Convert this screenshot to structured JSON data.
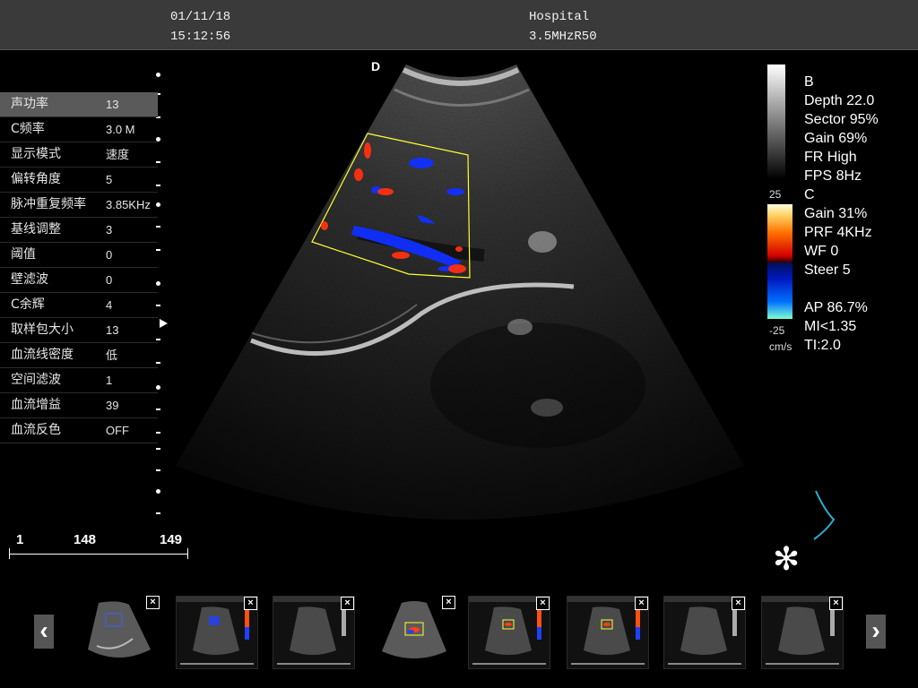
{
  "header": {
    "date": "01/11/18",
    "time": "15:12:56",
    "institution": "Hospital",
    "probe": "3.5MHzR50"
  },
  "orientation_marker": "D",
  "params": [
    {
      "label": "声功率",
      "value": "13",
      "selected": true
    },
    {
      "label": "C频率",
      "value": "3.0 M"
    },
    {
      "label": "显示模式",
      "value": "速度"
    },
    {
      "label": "偏转角度",
      "value": "5"
    },
    {
      "label": "脉冲重复频率",
      "value": "3.85KHz"
    },
    {
      "label": "基线调整",
      "value": "3"
    },
    {
      "label": "阈值",
      "value": "0"
    },
    {
      "label": "壁滤波",
      "value": "0"
    },
    {
      "label": "C余辉",
      "value": "4"
    },
    {
      "label": "取样包大小",
      "value": "13"
    },
    {
      "label": "血流线密度",
      "value": "低"
    },
    {
      "label": "空间滤波",
      "value": "1"
    },
    {
      "label": "血流增益",
      "value": "39"
    },
    {
      "label": "血流反色",
      "value": "OFF"
    }
  ],
  "info": {
    "b_mode": "B",
    "depth": "Depth 22.0",
    "sector": "Sector 95%",
    "gain": "Gain 69%",
    "fr": "FR High",
    "fps": "FPS 8Hz",
    "c_mode": "C",
    "c_gain": "Gain  31%",
    "prf": "PRF 4KHz",
    "wf": "WF 0",
    "steer": "Steer 5",
    "ap": "AP 86.7%",
    "mi": "MI<1.35",
    "ti": "TI:2.0"
  },
  "color_scale": {
    "max": "25",
    "min": "-25",
    "unit": "cm/s"
  },
  "ruler": {
    "start": "1",
    "current": "148",
    "end": "149"
  },
  "thumbnails": [
    {
      "type": "color-doppler-image"
    },
    {
      "type": "screen-capture-color"
    },
    {
      "type": "screen-capture-gray"
    },
    {
      "type": "color-doppler-image"
    },
    {
      "type": "screen-capture-color"
    },
    {
      "type": "screen-capture-color"
    },
    {
      "type": "screen-capture-gray"
    },
    {
      "type": "screen-capture-gray"
    }
  ],
  "thumbnail_close": "×",
  "nav": {
    "prev_icon": "chevron-left-icon",
    "next_icon": "chevron-right-icon"
  },
  "freeze_icon": "snowflake-icon",
  "colors": {
    "flow_red": "#ff3010",
    "flow_blue": "#1030ff",
    "roi_box": "#ffff33",
    "trace": "#2ab0d0"
  }
}
